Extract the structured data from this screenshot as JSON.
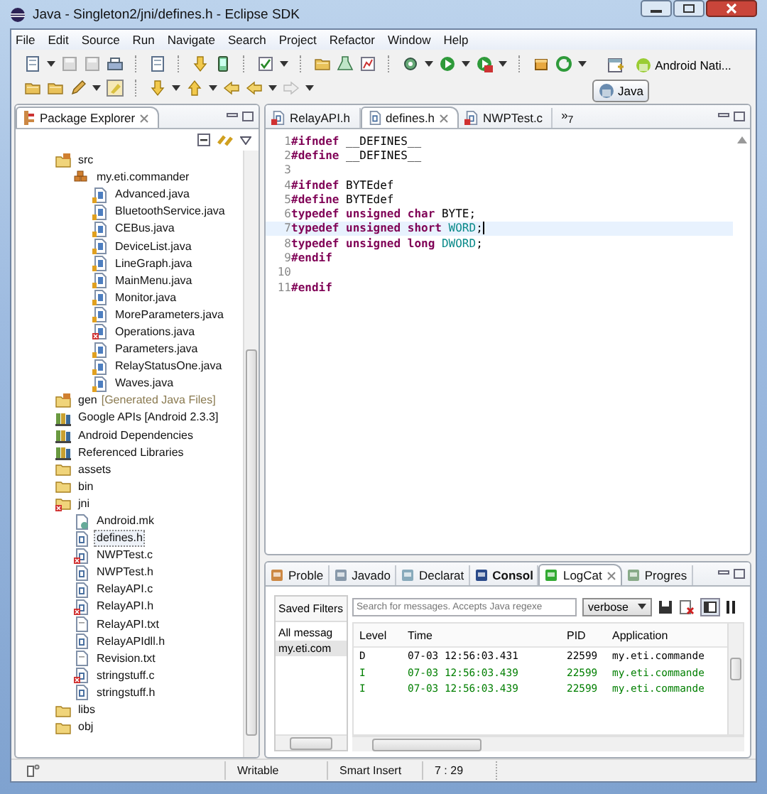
{
  "window": {
    "title": "Java - Singleton2/jni/defines.h - Eclipse SDK"
  },
  "menu": [
    "File",
    "Edit",
    "Source",
    "Run",
    "Navigate",
    "Search",
    "Project",
    "Refactor",
    "Window",
    "Help"
  ],
  "perspectives": [
    {
      "label": "Android Nati...",
      "selected": false
    },
    {
      "label": "Java",
      "selected": true
    }
  ],
  "package_explorer": {
    "title": "Package Explorer",
    "tree": [
      {
        "label": "src",
        "kind": "src-folder",
        "selected": false,
        "children": [
          {
            "label": "my.eti.commander",
            "kind": "package",
            "selected": false,
            "children": [
              {
                "label": "Advanced.java",
                "kind": "java",
                "selected": false
              },
              {
                "label": "BluetoothService.java",
                "kind": "java",
                "selected": false
              },
              {
                "label": "CEBus.java",
                "kind": "java",
                "selected": false
              },
              {
                "label": "DeviceList.java",
                "kind": "java",
                "selected": false
              },
              {
                "label": "LineGraph.java",
                "kind": "java",
                "selected": false
              },
              {
                "label": "MainMenu.java",
                "kind": "java",
                "selected": false
              },
              {
                "label": "Monitor.java",
                "kind": "java",
                "selected": false
              },
              {
                "label": "MoreParameters.java",
                "kind": "java",
                "selected": false
              },
              {
                "label": "Operations.java",
                "kind": "java-error",
                "selected": false
              },
              {
                "label": "Parameters.java",
                "kind": "java",
                "selected": false
              },
              {
                "label": "RelayStatusOne.java",
                "kind": "java",
                "selected": false
              },
              {
                "label": "Waves.java",
                "kind": "java",
                "selected": false
              }
            ]
          }
        ]
      },
      {
        "label": "gen",
        "note": "[Generated Java Files]",
        "kind": "src-folder",
        "selected": false
      },
      {
        "label": "Google APIs [Android 2.3.3]",
        "kind": "library",
        "selected": false
      },
      {
        "label": "Android Dependencies",
        "kind": "library",
        "selected": false
      },
      {
        "label": "Referenced Libraries",
        "kind": "library",
        "selected": false
      },
      {
        "label": "assets",
        "kind": "folder",
        "selected": false
      },
      {
        "label": "bin",
        "kind": "folder",
        "selected": false
      },
      {
        "label": "jni",
        "kind": "folder-error",
        "selected": false,
        "children": [
          {
            "label": "Android.mk",
            "kind": "mk",
            "selected": false
          },
          {
            "label": "defines.h",
            "kind": "c",
            "selected": true
          },
          {
            "label": "NWPTest.c",
            "kind": "c-error",
            "selected": false
          },
          {
            "label": "NWPTest.h",
            "kind": "c",
            "selected": false
          },
          {
            "label": "RelayAPI.c",
            "kind": "c",
            "selected": false
          },
          {
            "label": "RelayAPI.h",
            "kind": "c-error",
            "selected": false
          },
          {
            "label": "RelayAPI.txt",
            "kind": "txt",
            "selected": false
          },
          {
            "label": "RelayAPIdll.h",
            "kind": "c",
            "selected": false
          },
          {
            "label": "Revision.txt",
            "kind": "txt",
            "selected": false
          },
          {
            "label": "stringstuff.c",
            "kind": "c-error",
            "selected": false
          },
          {
            "label": "stringstuff.h",
            "kind": "c",
            "selected": false
          }
        ]
      },
      {
        "label": "libs",
        "kind": "folder",
        "selected": false
      },
      {
        "label": "obj",
        "kind": "folder",
        "selected": false
      }
    ]
  },
  "editor": {
    "tabs": [
      {
        "label": "RelayAPI.h",
        "kind": "c-error",
        "selected": false
      },
      {
        "label": "defines.h",
        "kind": "c",
        "selected": true
      },
      {
        "label": "NWPTest.c",
        "kind": "c-error",
        "selected": false
      }
    ],
    "overflow": "»$_{7}$",
    "lines": [
      {
        "n": "1",
        "current": false,
        "tokens": [
          {
            "text": "#ifndef",
            "kind": "keyword"
          },
          {
            "text": " __DEFINES__",
            "kind": "plain"
          }
        ]
      },
      {
        "n": "2",
        "current": false,
        "tokens": [
          {
            "text": "#define",
            "kind": "keyword"
          },
          {
            "text": " __DEFINES__",
            "kind": "plain"
          }
        ]
      },
      {
        "n": "3",
        "current": false
      },
      {
        "n": "4",
        "current": false,
        "tokens": [
          {
            "text": "#ifndef",
            "kind": "keyword"
          },
          {
            "text": " BYTEdef",
            "kind": "plain"
          }
        ]
      },
      {
        "n": "5",
        "current": false,
        "tokens": [
          {
            "text": "#define",
            "kind": "keyword"
          },
          {
            "text": " BYTEdef",
            "kind": "plain"
          }
        ]
      },
      {
        "n": "6",
        "current": false,
        "tokens": [
          {
            "text": "typedef unsigned char",
            "kind": "keyword"
          },
          {
            "text": " BYTE;",
            "kind": "plain"
          }
        ]
      },
      {
        "n": "7",
        "current": true,
        "tokens": [
          {
            "text": "typedef unsigned short",
            "kind": "keyword"
          },
          {
            "text": " WORD",
            "kind": "type"
          },
          {
            "text": ";",
            "kind": "plain"
          }
        ]
      },
      {
        "n": "8",
        "current": false,
        "tokens": [
          {
            "text": "typedef unsigned long",
            "kind": "keyword"
          },
          {
            "text": " DWORD",
            "kind": "type"
          },
          {
            "text": ";",
            "kind": "plain"
          }
        ]
      },
      {
        "n": "9",
        "current": false,
        "tokens": [
          {
            "text": "#endif",
            "kind": "keyword"
          }
        ]
      },
      {
        "n": "10",
        "current": false
      },
      {
        "n": "11",
        "current": false,
        "tokens": [
          {
            "text": "#endif",
            "kind": "keyword"
          }
        ]
      }
    ]
  },
  "console": {
    "tabs": [
      {
        "label": "Proble",
        "selected": false,
        "bold": false
      },
      {
        "label": "Javado",
        "selected": false,
        "bold": false
      },
      {
        "label": "Declarat",
        "selected": false,
        "bold": false
      },
      {
        "label": "Consol",
        "selected": false,
        "bold": true
      },
      {
        "label": "LogCat",
        "selected": true,
        "bold": false
      },
      {
        "label": "Progres",
        "selected": false,
        "bold": false
      }
    ],
    "saved_filters": {
      "title": "Saved Filters",
      "items": [
        {
          "label": "All messag",
          "selected": false
        },
        {
          "label": "my.eti.com",
          "selected": true
        }
      ]
    },
    "search": {
      "placeholder": "Search for messages. Accepts Java regexe"
    },
    "level_dropdown": "verbose",
    "columns": [
      "Level",
      "Time",
      "PID",
      "Application"
    ],
    "rows": [
      {
        "level": "D",
        "time": "07-03 12:56:03.431",
        "pid": "22599",
        "application": "my.eti.commande",
        "color": "#000000"
      },
      {
        "level": "I",
        "time": "07-03 12:56:03.439",
        "pid": "22599",
        "application": "my.eti.commande",
        "color": "#007f00"
      },
      {
        "level": "I",
        "time": "07-03 12:56:03.439",
        "pid": "22599",
        "application": "my.eti.commande",
        "color": "#007f00"
      }
    ]
  },
  "status_bar": [
    "Writable",
    "Smart Insert",
    "7 : 29"
  ]
}
